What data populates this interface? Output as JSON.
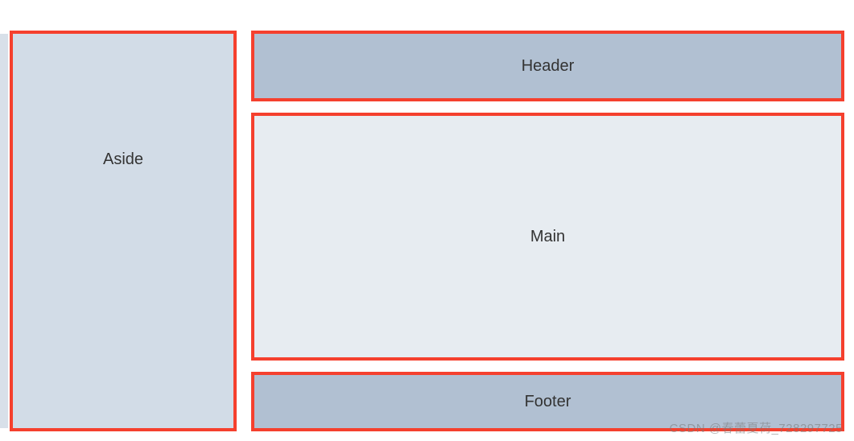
{
  "layout": {
    "aside": {
      "label": "Aside"
    },
    "header": {
      "label": "Header"
    },
    "main": {
      "label": "Main"
    },
    "footer": {
      "label": "Footer"
    }
  },
  "watermark": {
    "text": "CSDN @春蕾夏荷_728297725"
  },
  "colors": {
    "border": "#f5402e",
    "aside_bg": "#d2dce7",
    "header_bg": "#b1c0d2",
    "main_bg": "#e7ecf1",
    "footer_bg": "#b1c0d2"
  }
}
